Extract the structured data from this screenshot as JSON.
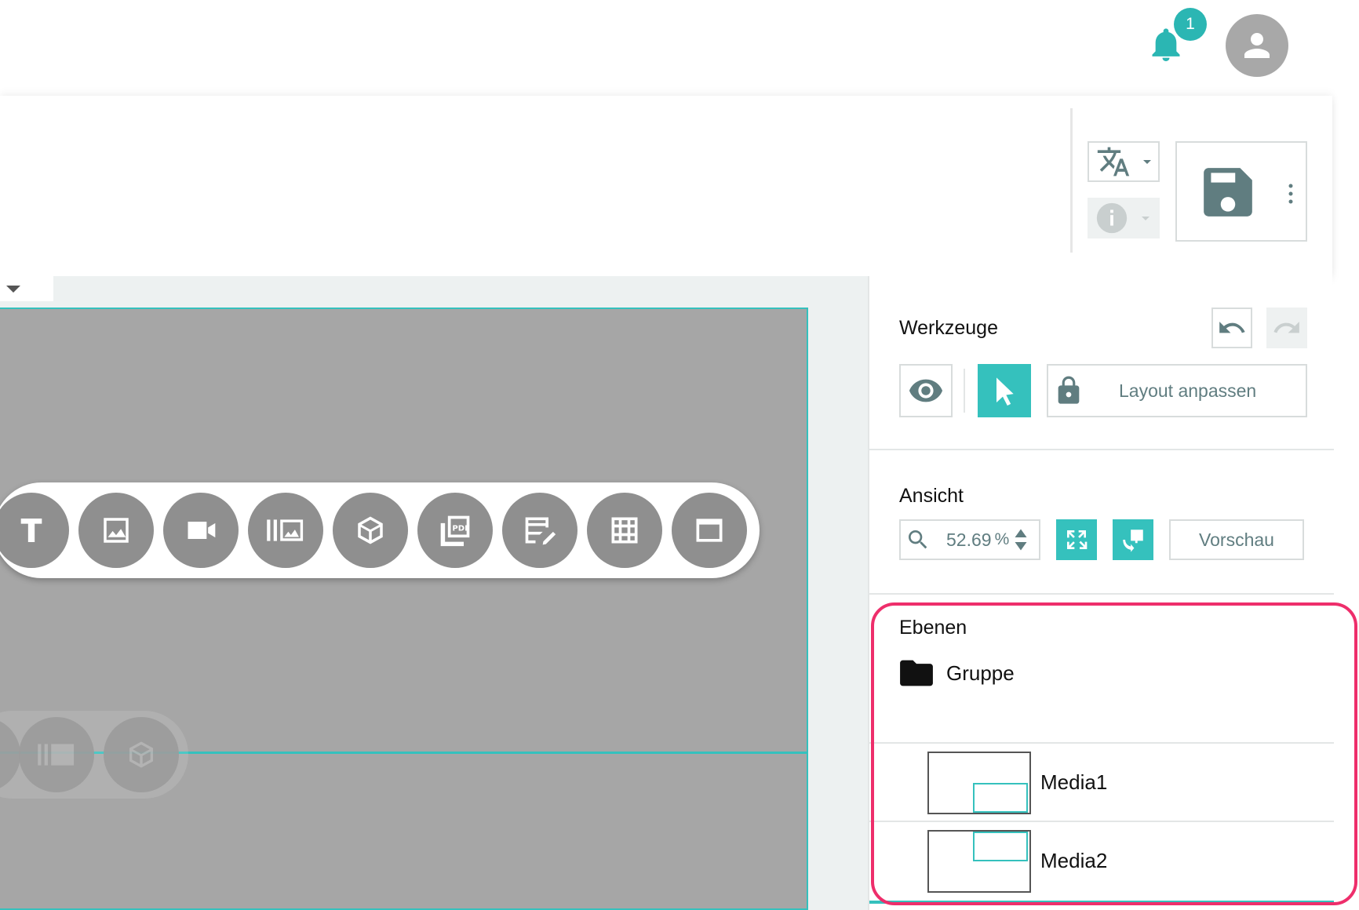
{
  "header": {
    "notification_count": "1",
    "bell_icon": "bell-icon",
    "avatar_icon": "person-icon"
  },
  "toolbar": {
    "language_icon": "translate-icon",
    "info_icon": "info-icon",
    "save_icon": "floppy-disk-icon",
    "more_icon": "more-vertical-icon"
  },
  "canvas": {
    "palette_items": [
      {
        "name": "text",
        "icon": "text-icon"
      },
      {
        "name": "image",
        "icon": "image-icon"
      },
      {
        "name": "video",
        "icon": "video-icon"
      },
      {
        "name": "gallery",
        "icon": "gallery-icon"
      },
      {
        "name": "3d-object",
        "icon": "cube-icon"
      },
      {
        "name": "pdf",
        "icon": "pdf-icon"
      },
      {
        "name": "form",
        "icon": "form-edit-icon"
      },
      {
        "name": "table",
        "icon": "table-icon"
      },
      {
        "name": "frame",
        "icon": "window-icon"
      }
    ]
  },
  "panel": {
    "tools": {
      "title": "Werkzeuge",
      "layout_label": "Layout anpassen"
    },
    "view": {
      "title": "Ansicht",
      "zoom_value": "52.69",
      "zoom_unit": "%",
      "preview_label": "Vorschau"
    },
    "layers": {
      "title": "Ebenen",
      "group_label": "Gruppe",
      "items": [
        {
          "label": "Media1"
        },
        {
          "label": "Media2"
        }
      ]
    }
  },
  "colors": {
    "accent": "#35c1bd",
    "highlight": "#ee2e6b",
    "canvas": "#a6a6a6",
    "icon_gray": "#607d80"
  }
}
